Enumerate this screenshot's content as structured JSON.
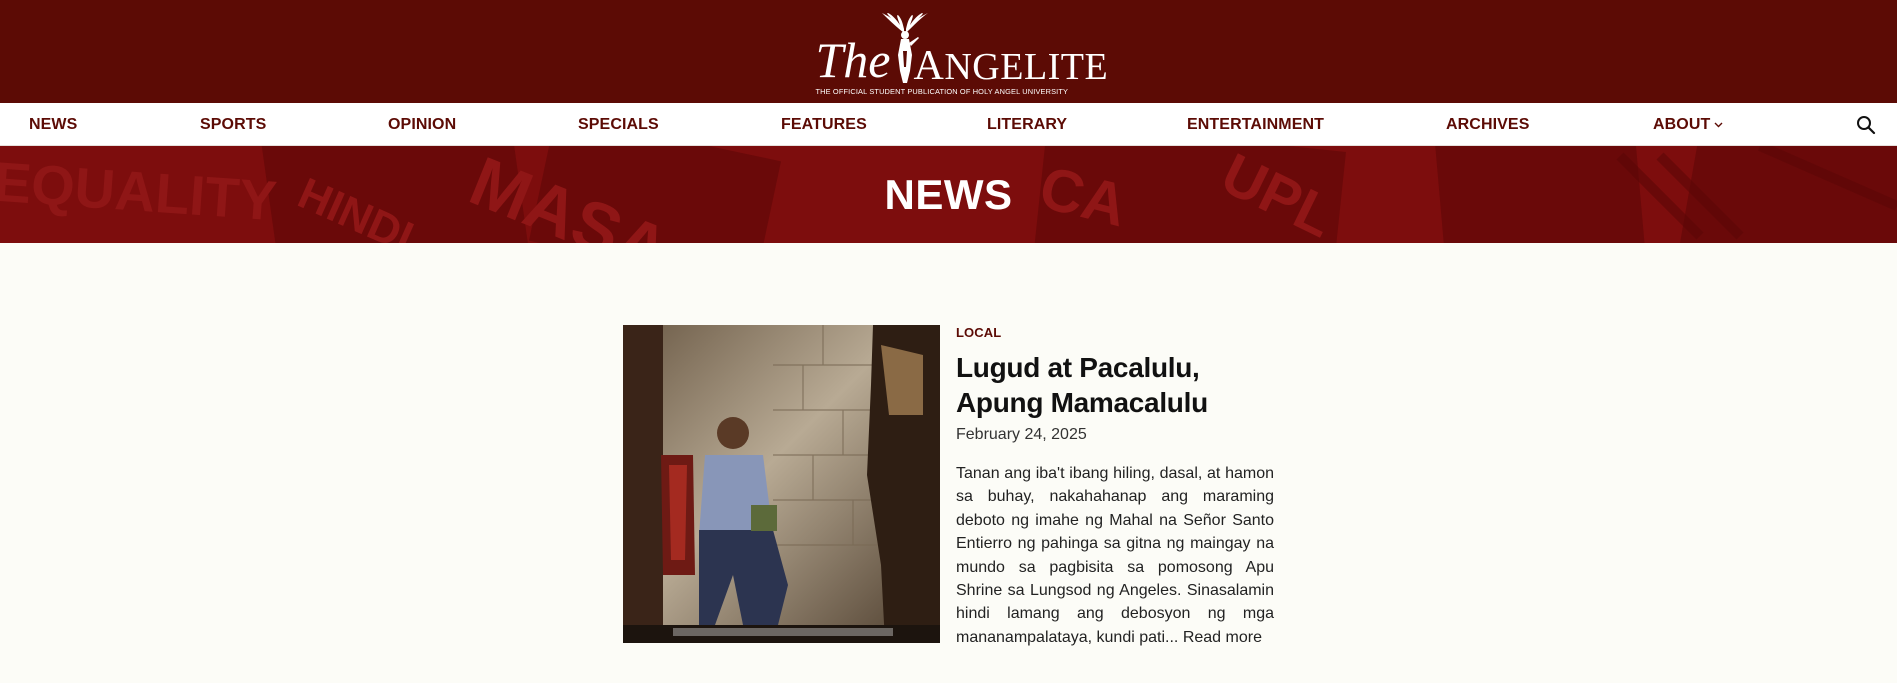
{
  "header": {
    "logo_the": "The",
    "logo_name_first": "A",
    "logo_name_rest": "NGELITE",
    "tagline": "THE OFFICIAL STUDENT PUBLICATION OF HOLY ANGEL UNIVERSITY"
  },
  "nav": {
    "items": [
      {
        "label": "NEWS"
      },
      {
        "label": "SPORTS"
      },
      {
        "label": "OPINION"
      },
      {
        "label": "SPECIALS"
      },
      {
        "label": "FEATURES"
      },
      {
        "label": "LITERARY"
      },
      {
        "label": "ENTERTAINMENT"
      },
      {
        "label": "ARCHIVES"
      },
      {
        "label": "ABOUT"
      }
    ]
  },
  "banner": {
    "title": "NEWS",
    "background_words": [
      "EQUALITY",
      "HINDI",
      "MASA",
      "CA",
      "UPL"
    ]
  },
  "article": {
    "category": "LOCAL",
    "title": "Lugud at Pacalulu, Apung Mamacalulu",
    "date": "February 24, 2025",
    "excerpt": "Tanan ang iba't ibang hiling, dasal, at hamon sa buhay, nakahahanap ang maraming deboto ng imahe ng Mahal na Señor Santo Entierro ng pahinga sa gitna ng maingay na mundo sa pagbisita sa pomosong Apu Shrine sa Lungsod ng Angeles. Sinasalamin hindi lamang ang debosyon ng mga mananampalataya, kundi pati...",
    "read_more": "Read more"
  },
  "colors": {
    "brand": "#5c0b05",
    "banner": "#7a0c0c",
    "page_bg": "#fcfcf7"
  }
}
